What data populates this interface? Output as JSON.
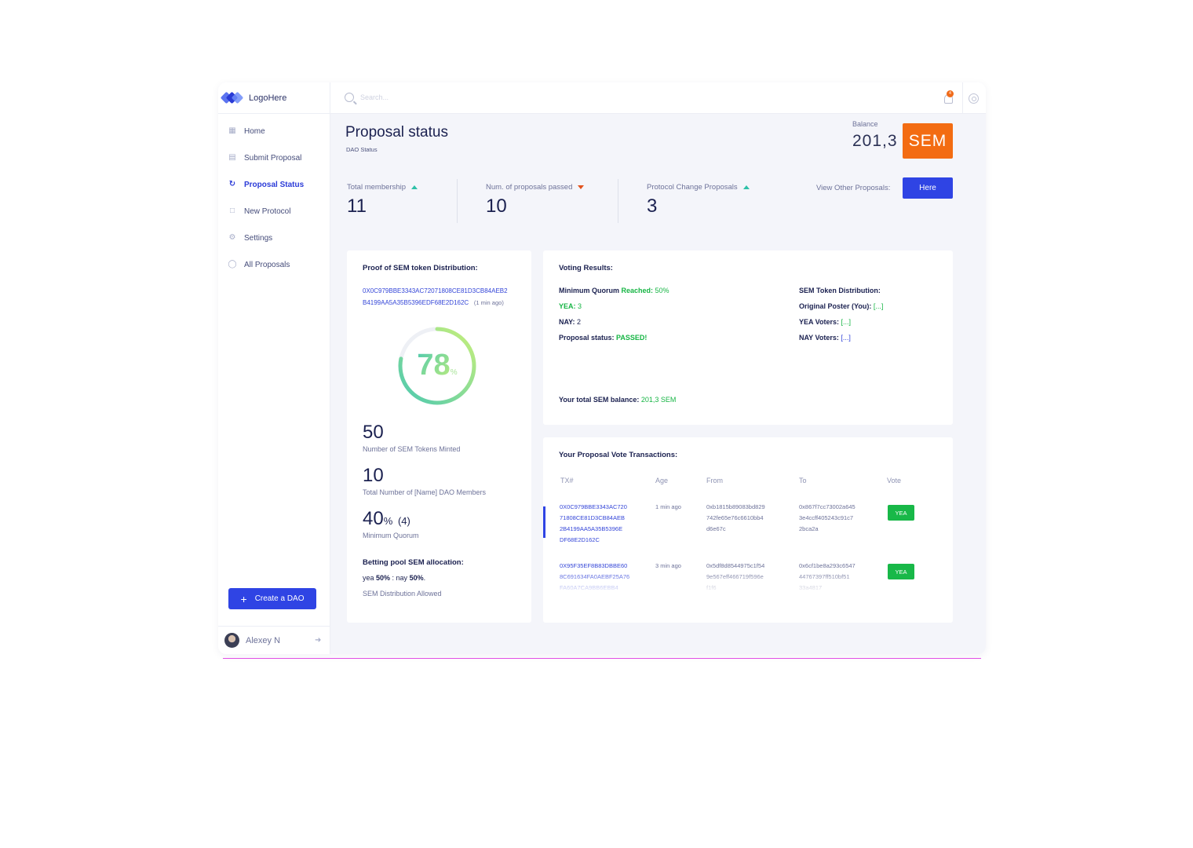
{
  "app": {
    "logo_text": "LogoHere",
    "search_placeholder": "Search...",
    "notification_count": "4"
  },
  "sidebar": {
    "items": [
      {
        "label": "Home",
        "icon": "dashboard-icon"
      },
      {
        "label": "Submit Proposal",
        "icon": "chart-icon"
      },
      {
        "label": "Proposal Status",
        "icon": "refresh-icon",
        "active": true
      },
      {
        "label": "New Protocol",
        "icon": "document-icon"
      },
      {
        "label": "Settings",
        "icon": "gear-icon"
      },
      {
        "label": "All Proposals",
        "icon": "globe-icon"
      }
    ],
    "create_button": "Create a DAO",
    "user_name": "Alexey N"
  },
  "header": {
    "title": "Proposal status",
    "subtitle": "DAO Status",
    "balance_label": "Balance",
    "balance_value": "201,3",
    "balance_unit": "SEM"
  },
  "stats": [
    {
      "label": "Total membership",
      "value": "11",
      "trend": "up"
    },
    {
      "label": "Num. of proposals passed",
      "value": "10",
      "trend": "down"
    },
    {
      "label": "Protocol Change Proposals",
      "value": "3",
      "trend": "up"
    }
  ],
  "view_other": {
    "label": "View Other Proposals:",
    "button": "Here"
  },
  "proof": {
    "title": "Proof of SEM token Distribution:",
    "hash_line1": "0X0C979BBE3343AC72071808CE81D3CB84AEB2",
    "hash_line2": "B4199AA5A35B5396EDF68E2D162C",
    "hash_age": "(1 min ago)",
    "gauge_value": 78,
    "gauge_text": "78",
    "gauge_unit": "%",
    "tokens_minted": "50",
    "tokens_minted_label": "Number of SEM Tokens Minted",
    "members": "10",
    "members_label": "Total Number of [Name] DAO Members",
    "quorum_value": "40",
    "quorum_unit": "%",
    "quorum_count": "(4)",
    "quorum_label": "Minimum Quorum",
    "betting_title": "Betting pool SEM allocation:",
    "betting_yea_label": "yea",
    "betting_yea": "50%",
    "betting_sep": " : nay",
    "betting_nay": "50%",
    "betting_dot": ".",
    "distribution_allowed": "SEM Distribution Allowed"
  },
  "voting": {
    "title": "Voting Results:",
    "quorum_label": "Minimum Quorum",
    "quorum_status": "Reached:",
    "quorum_value": "50%",
    "yea_label": "YEA:",
    "yea_value": "3",
    "nay_label": "NAY:",
    "nay_value": "2",
    "status_label": "Proposal status:",
    "status_value": "PASSED!",
    "dist_title": "SEM Token Distribution:",
    "op_label": "Original Poster (You):",
    "op_value": "[...]",
    "yea_voters_label": "YEA Voters:",
    "yea_voters_value": "[...]",
    "nay_voters_label": "NAY Voters:",
    "nay_voters_value": "[...]",
    "total_label": "Your total SEM balance:",
    "total_value": "201,3 SEM"
  },
  "transactions": {
    "title": "Your Proposal Vote Transactions:",
    "columns": [
      "TX#",
      "Age",
      "From",
      "To",
      "Vote"
    ],
    "rows": [
      {
        "tx": [
          "0X0C979BBE3343AC720",
          "71808CE81D3CB84AEB",
          "2B4199AA5A35B5396E",
          "DF68E2D162C"
        ],
        "age": "1 min ago",
        "from": [
          "0xb1815b89083bd829",
          "742fe65e76c6610bb4",
          "d6e67c"
        ],
        "to": [
          "0x867f7cc73002a645",
          "3e4ccff405243c91c7",
          "2bca2a"
        ],
        "vote": "YEA"
      },
      {
        "tx": [
          "0X95F35EF8B83DBBE60",
          "8C691634FA0AEBF25A76",
          "FA60A7CA9BB6EBB4"
        ],
        "age": "3 min ago",
        "from": [
          "0x5df8d8544975c1f54",
          "9e567eff466719f596e",
          "f1f6"
        ],
        "to": [
          "0x6cf1be8a293c6547",
          "44767397ff510bf51",
          "33a4817"
        ],
        "vote": "YEA"
      }
    ]
  },
  "colors": {
    "primary": "#2f44e4",
    "accent_orange": "#f36c12",
    "success": "#16b544",
    "gauge_start": "#4cc9b0",
    "gauge_end": "#c9f07a"
  }
}
